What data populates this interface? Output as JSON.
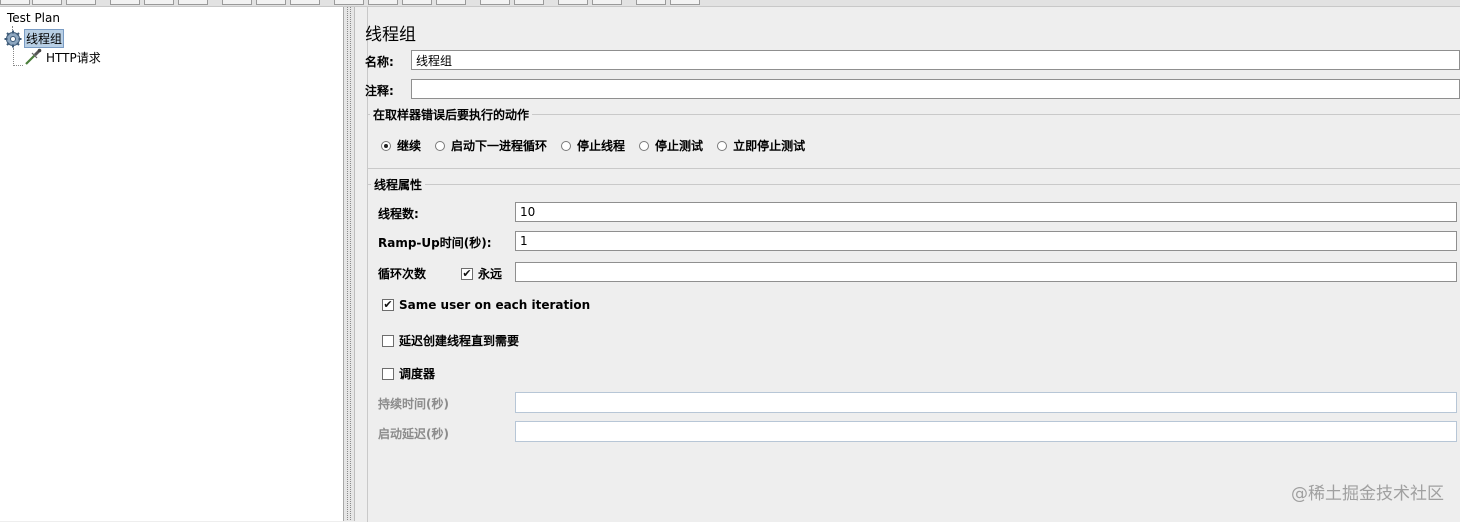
{
  "tree": {
    "root_label": "Test Plan",
    "thread_group_label": "线程组",
    "http_request_label": "HTTP请求"
  },
  "panel": {
    "title": "线程组",
    "name_label": "名称:",
    "name_value": "线程组",
    "comment_label": "注释:",
    "comment_value": ""
  },
  "error_action": {
    "group_title": "在取样器错误后要执行的动作",
    "options": [
      {
        "label": "继续",
        "selected": true
      },
      {
        "label": "启动下一进程循环",
        "selected": false
      },
      {
        "label": "停止线程",
        "selected": false
      },
      {
        "label": "停止测试",
        "selected": false
      },
      {
        "label": "立即停止测试",
        "selected": false
      }
    ]
  },
  "thread_props": {
    "group_title": "线程属性",
    "threads_label": "线程数:",
    "threads_value": "10",
    "rampup_label": "Ramp-Up时间(秒):",
    "rampup_value": "1",
    "loop_label": "循环次数",
    "forever_label": "永远",
    "forever_checked": true,
    "loop_value": "",
    "same_user_label": "Same user on each iteration",
    "same_user_checked": true,
    "delay_create_label": "延迟创建线程直到需要",
    "delay_create_checked": false,
    "scheduler_label": "调度器",
    "scheduler_checked": false,
    "duration_label": "持续时间(秒)",
    "duration_value": "",
    "startup_delay_label": "启动延迟(秒)",
    "startup_delay_value": ""
  },
  "watermark": "@稀土掘金技术社区",
  "icons": {
    "thread_group": "gear-icon",
    "http_request": "pipette-icon"
  }
}
